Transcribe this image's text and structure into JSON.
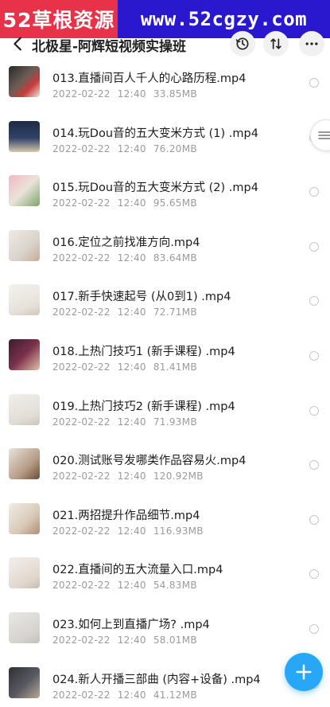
{
  "watermark": {
    "left_text": "52草根资源",
    "right_text": "www.52cgzy.com"
  },
  "header": {
    "title": "北极星-阿辉短视频实操班"
  },
  "icons": {
    "back": "back-arrow-icon",
    "history": "history-icon",
    "sort": "sort-icon",
    "more": "more-icon",
    "side_handle": "menu-handle-icon",
    "fab": "plus-icon"
  },
  "colors": {
    "fab": "#27a7f5",
    "watermark_left": "#e8324a",
    "watermark_right": "#2a18cf"
  },
  "files": [
    {
      "name": "013.直播间百人千人的心路历程.mp4",
      "date": "2022-02-22",
      "time": "12:40",
      "size": "33.85MB"
    },
    {
      "name": "014.玩Dou音的五大变米方式 (1) .mp4",
      "date": "2022-02-22",
      "time": "12:40",
      "size": "76.20MB"
    },
    {
      "name": "015.玩Dou音的五大变米方式 (2) .mp4",
      "date": "2022-02-22",
      "time": "12:40",
      "size": "95.65MB"
    },
    {
      "name": "016.定位之前找准方向.mp4",
      "date": "2022-02-22",
      "time": "12:40",
      "size": "83.64MB"
    },
    {
      "name": "017.新手快速起号 (从0到1) .mp4",
      "date": "2022-02-22",
      "time": "12:40",
      "size": "72.71MB"
    },
    {
      "name": "018.上热门技巧1 (新手课程) .mp4",
      "date": "2022-02-22",
      "time": "12:40",
      "size": "81.41MB"
    },
    {
      "name": "019.上热门技巧2 (新手课程) .mp4",
      "date": "2022-02-22",
      "time": "12:40",
      "size": "71.93MB"
    },
    {
      "name": "020.测试账号发哪类作品容易火.mp4",
      "date": "2022-02-22",
      "time": "12:40",
      "size": "120.92MB"
    },
    {
      "name": "021.两招提升作品细节.mp4",
      "date": "2022-02-22",
      "time": "12:40",
      "size": "116.93MB"
    },
    {
      "name": "022.直播间的五大流量入口.mp4",
      "date": "2022-02-22",
      "time": "12:40",
      "size": "54.83MB"
    },
    {
      "name": "023.如何上到直播广场? .mp4",
      "date": "2022-02-22",
      "time": "12:40",
      "size": "58.01MB"
    },
    {
      "name": "024.新人开播三部曲 (内容+设备) .mp4",
      "date": "2022-02-22",
      "time": "12:40",
      "size": "41.12MB"
    }
  ]
}
